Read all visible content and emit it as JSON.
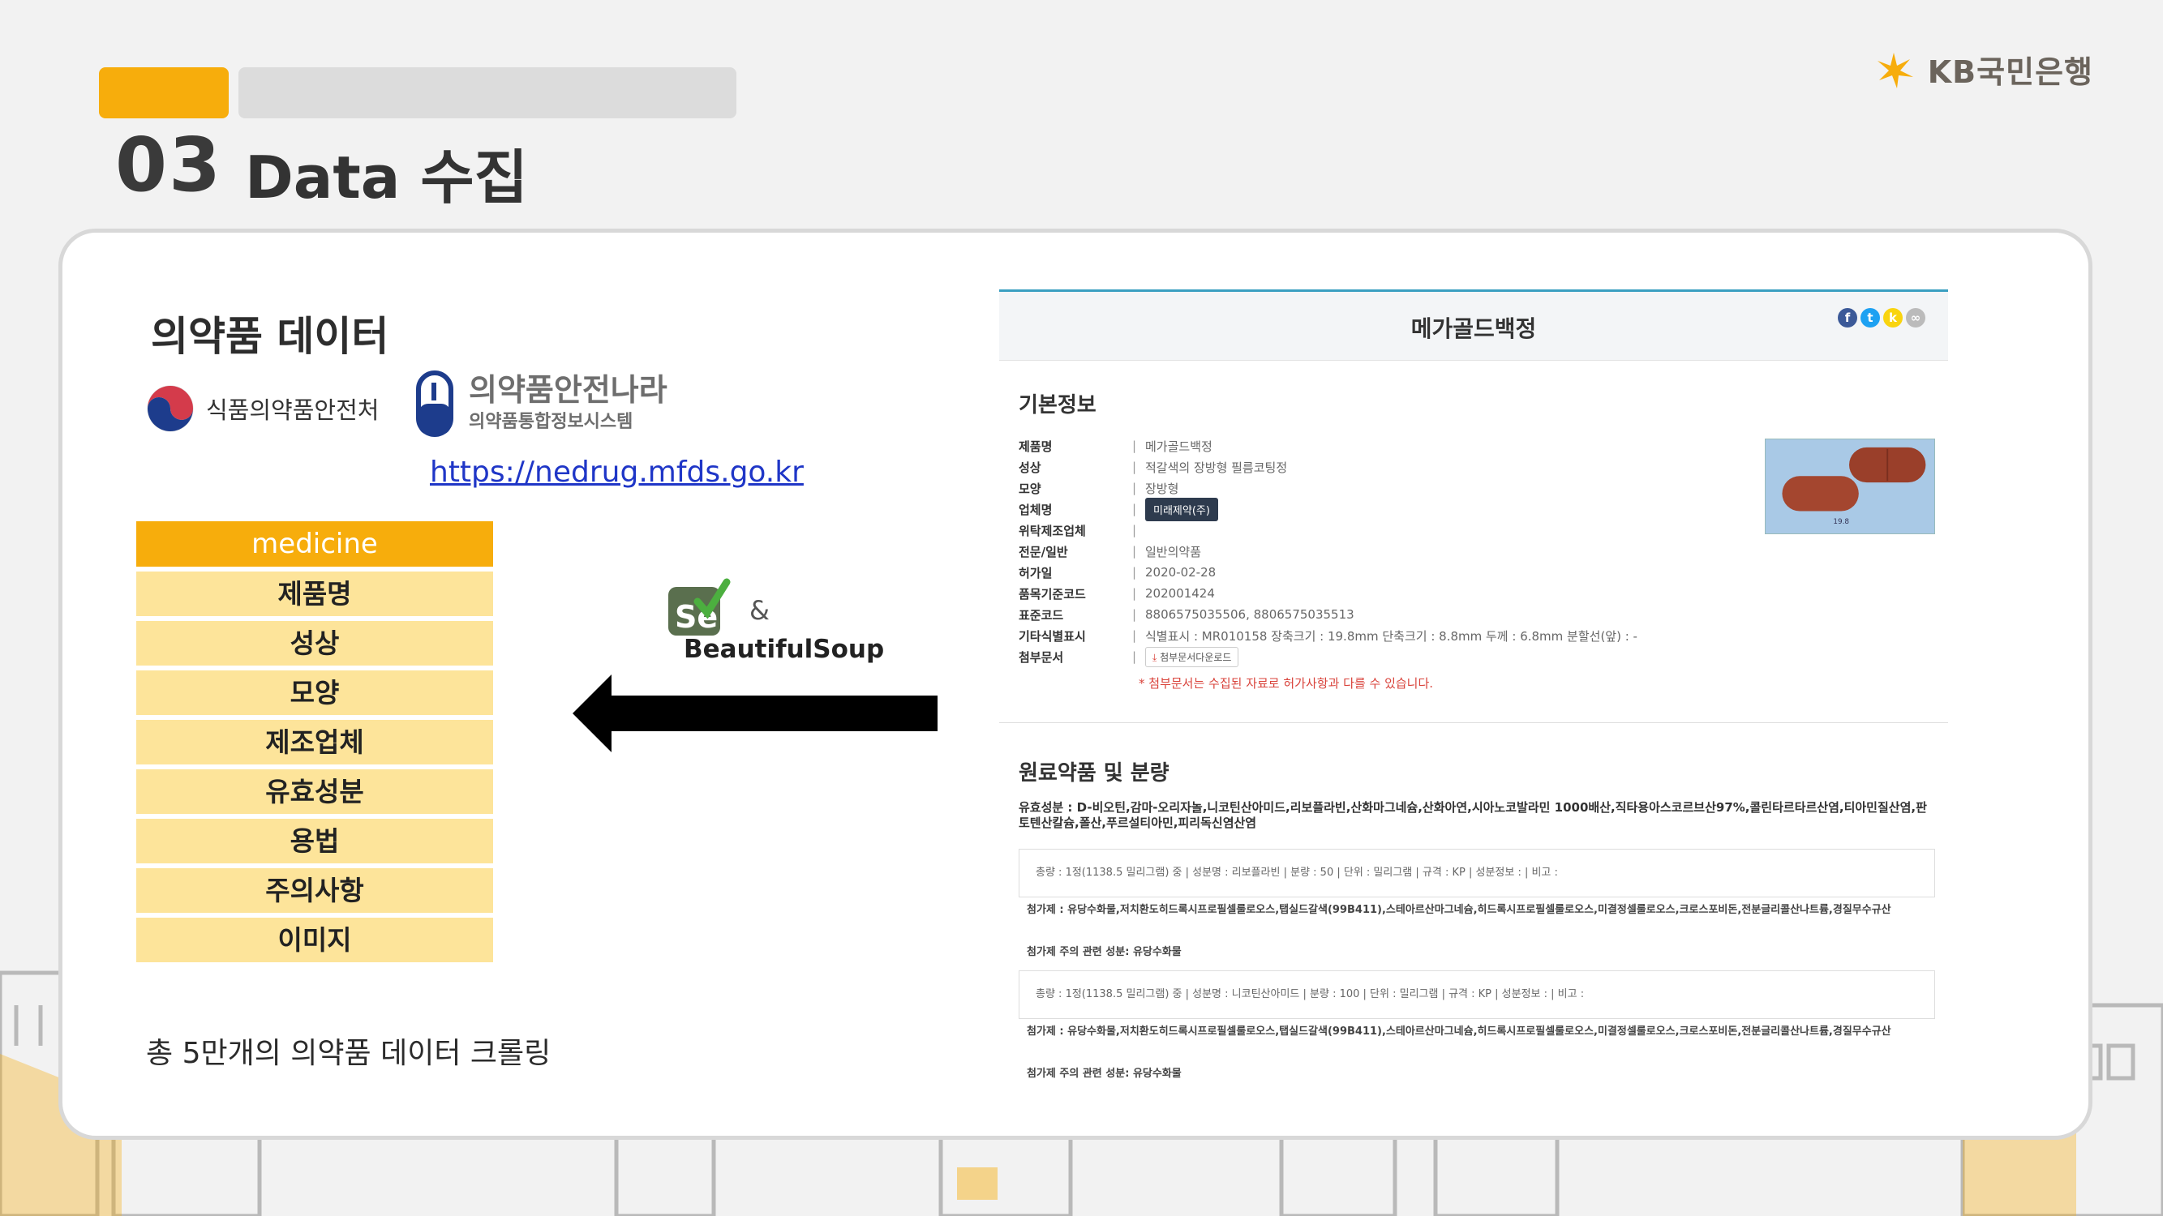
{
  "header": {
    "section_number": "03",
    "section_title": "Data 수집",
    "brand_name": "KB국민은행"
  },
  "left": {
    "heading": "의약품 데이터",
    "logo1_text": "식품의약품안전처",
    "logo2_main": "의약품안전나라",
    "logo2_sub": "의약품통합정보시스템",
    "url": "https://nedrug.mfds.go.kr",
    "schema_title": "medicine",
    "schema_fields": [
      "제품명",
      "성상",
      "모양",
      "제조업체",
      "유효성분",
      "용법",
      "주의사항",
      "이미지"
    ],
    "footnote": "총 5만개의 의약품 데이터 크롤링",
    "tools": {
      "selenium": "Se",
      "amp": "&",
      "bs": "BeautifulSoup"
    }
  },
  "site": {
    "title": "메가골드백정",
    "basic_heading": "기본정보",
    "rows": [
      {
        "k": "제품명",
        "v": "메가골드백정"
      },
      {
        "k": "성상",
        "v": "적갈색의 장방형 필름코팅정"
      },
      {
        "k": "모양",
        "v": "장방형"
      },
      {
        "k": "업체명",
        "v": "미래제약(주)"
      },
      {
        "k": "위탁제조업체",
        "v": ""
      },
      {
        "k": "전문/일반",
        "v": "일반의약품"
      },
      {
        "k": "허가일",
        "v": "2020-02-28"
      },
      {
        "k": "품목기준코드",
        "v": "202001424"
      },
      {
        "k": "표준코드",
        "v": "8806575035506, 8806575035513"
      },
      {
        "k": "기타식별표시",
        "v": "식별표시 : MR010158 장축크기 : 19.8mm 단축크기 : 8.8mm 두께 : 6.8mm 분할선(앞) : -"
      },
      {
        "k": "첨부문서",
        "v": "첨부문서다운로드"
      }
    ],
    "warning": "* 첨부문서는 수집된 자료로 허가사항과 다를 수 있습니다.",
    "ing_heading": "원료약품 및 분량",
    "ingredients": "유효성분 : D-비오틴,감마-오리자놀,니코틴산아미드,리보플라빈,산화마그네슘,산화아연,시아노코발라민 1000배산,직타용아스코르브산97%,콜린타르타르산염,티아민질산염,판토텐산칼슘,폴산,푸르설티아민,피리독신염산염",
    "box1": "총량 : 1정(1138.5 밀리그램) 중 | 성분명 : 리보플라빈 | 분량 : 50 | 단위 : 밀리그램 | 규격 : KP | 성분정보 : | 비고 :",
    "box2": "총량 : 1정(1138.5 밀리그램) 중 | 성분명 : 니코틴산아미드 | 분량 : 100 | 단위 : 밀리그램 | 규격 : KP | 성분정보 : | 비고 :",
    "additive": "첨가제 : 유당수화물,저치환도히드록시프로필셀룰로오스,탭실드갈색(99B411),스테아르산마그네슘,히드록시프로필셀룰로오스,미결정셀룰로오스,크로스포비돈,전분글리콜산나트륨,경질무수규산",
    "note": "첨가제 주의 관련 성분: 유당수화물",
    "pill_scale": "19.8"
  },
  "colors": {
    "accent": "#f7ad0c",
    "schema_row": "#fde49a",
    "link": "#1f36c7"
  }
}
